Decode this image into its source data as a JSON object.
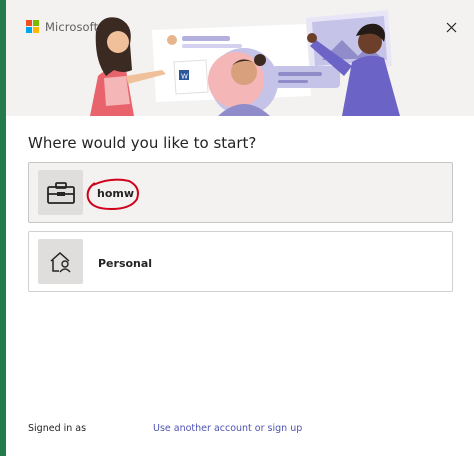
{
  "brand": {
    "name": "Microsoft",
    "logo_colors": [
      "#f25022",
      "#7fba00",
      "#00a4ef",
      "#ffb900"
    ]
  },
  "header": {
    "close_icon": "close-icon"
  },
  "main": {
    "title": "Where would you like to start?",
    "options": [
      {
        "label": "homw",
        "icon": "briefcase-icon",
        "selected": true,
        "annotation": "red hand-drawn circle around label"
      },
      {
        "label": "Personal",
        "icon": "home-person-icon",
        "selected": false
      }
    ]
  },
  "footer": {
    "signed_in_label": "Signed in as",
    "another_account_link": "Use another account or sign up"
  },
  "colors": {
    "accent_strip": "#237b4b",
    "banner_bg": "#f3f2f1",
    "link": "#4f52b2",
    "annotation_red": "#d0021b"
  }
}
